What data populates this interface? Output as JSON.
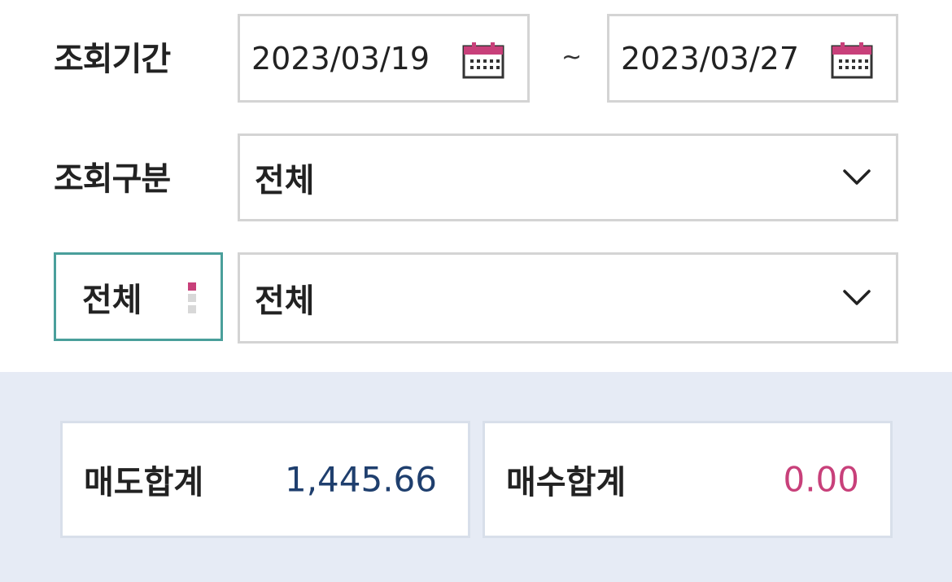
{
  "period": {
    "label": "조회기간",
    "start_date": "2023/03/19",
    "separator": "~",
    "end_date": "2023/03/27"
  },
  "category": {
    "label": "조회구분",
    "selected": "전체"
  },
  "filter": {
    "button_label": "전체",
    "selected": "전체"
  },
  "summary": {
    "sell_label": "매도합계",
    "sell_value": "1,445.66",
    "buy_label": "매수합계",
    "buy_value": "0.00"
  },
  "colors": {
    "accent_pink": "#c8407a",
    "sell_value_color": "#1f3f6e",
    "buy_value_color": "#c8407a",
    "filter_border": "#4a9f9b",
    "summary_background": "#e6ebf5"
  },
  "icons": {
    "calendar": "calendar-icon",
    "dropdown": "chevron-down-icon",
    "more": "vertical-dots-icon"
  }
}
